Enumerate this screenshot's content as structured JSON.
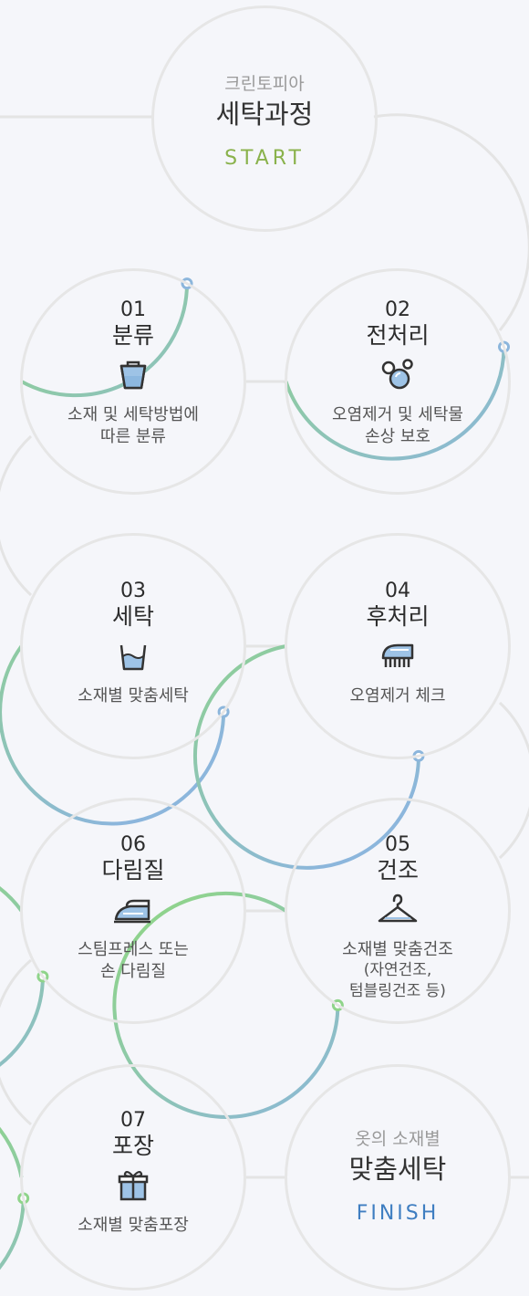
{
  "start": {
    "brand": "크린토피아",
    "title": "세탁과정",
    "label": "START"
  },
  "steps": [
    {
      "num": "01",
      "title": "분류",
      "icon": "bucket-icon",
      "desc": [
        "소재 및 세탁방법에",
        "따른 분류"
      ],
      "progress": 0.33
    },
    {
      "num": "02",
      "title": "전처리",
      "icon": "bubbles-icon",
      "desc": [
        "오염제거 및 세탁물",
        "손상 보호"
      ],
      "progress": 0.45
    },
    {
      "num": "03",
      "title": "세탁",
      "icon": "wash-tub-icon",
      "desc": [
        "소재별 맞춤세탁"
      ],
      "progress": 0.6
    },
    {
      "num": "04",
      "title": "후처리",
      "icon": "brush-icon",
      "desc": [
        "오염제거 체크"
      ],
      "progress": 0.72
    },
    {
      "num": "05",
      "title": "건조",
      "icon": "hanger-icon",
      "desc": [
        "소재별 맞춤건조",
        "(자연건조,",
        "텀블링건조 등)"
      ],
      "progress": 0.84
    },
    {
      "num": "06",
      "title": "다림질",
      "icon": "iron-icon",
      "desc": [
        "스팀프레스 또는",
        "손 다림질"
      ],
      "progress": 0.9
    },
    {
      "num": "07",
      "title": "포장",
      "icon": "gift-icon",
      "desc": [
        "소재별 맞춤포장"
      ],
      "progress": 0.97
    }
  ],
  "finish": {
    "top": "옷의 소재별",
    "title": "맞춤세탁",
    "label": "FINISH"
  },
  "colors": {
    "green": "#8fd48a",
    "blue": "#8cb6dc",
    "ring": "#e6e6e6",
    "start": "#8ab24c",
    "finish": "#3f7ec1"
  }
}
